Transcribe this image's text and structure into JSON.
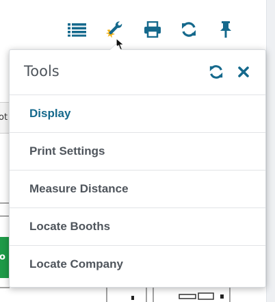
{
  "background": {
    "left_field_text": "ot",
    "green_button_text": "o"
  },
  "toolbar": {
    "icons": [
      "list-icon",
      "wrench-icon",
      "print-icon",
      "refresh-icon",
      "pin-icon"
    ]
  },
  "panel": {
    "title": "Tools",
    "items": [
      {
        "label": "Display",
        "active": true
      },
      {
        "label": "Print Settings",
        "active": false
      },
      {
        "label": "Measure Distance",
        "active": false
      },
      {
        "label": "Locate Booths",
        "active": false
      },
      {
        "label": "Locate Company",
        "active": false
      }
    ]
  },
  "colors": {
    "accent": "#15698c",
    "text": "#4f555c",
    "highlight": "#f5b316"
  }
}
